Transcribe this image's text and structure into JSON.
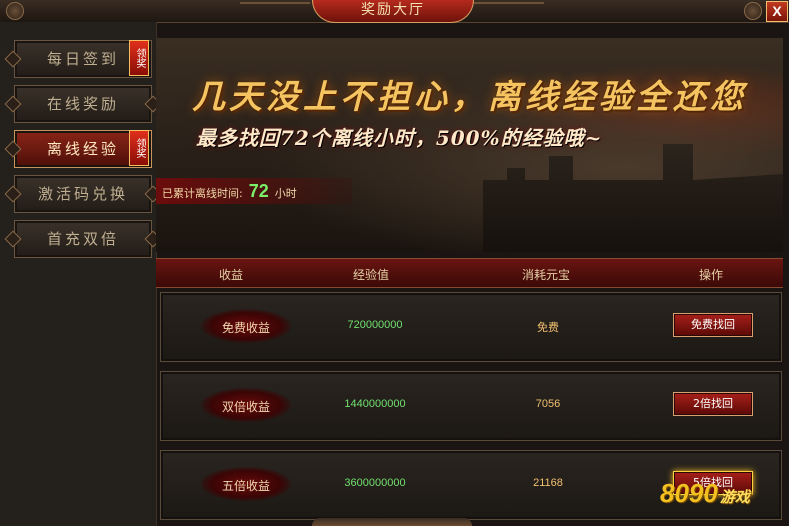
{
  "window": {
    "title": "奖励大厅",
    "close_label": "X"
  },
  "sidebar": {
    "items": [
      {
        "label": "每日签到",
        "badge": "领奖",
        "active": false
      },
      {
        "label": "在线奖励",
        "badge": "",
        "active": false
      },
      {
        "label": "离线经验",
        "badge": "领奖",
        "active": true
      },
      {
        "label": "激活码兑换",
        "badge": "",
        "active": false
      },
      {
        "label": "首充双倍",
        "badge": "",
        "active": false
      }
    ]
  },
  "banner": {
    "headline": "几天没上不担心，离线经验全还您",
    "subline": "最多找回72个离线小时，500%的经验哦~",
    "offline_label": "已累计离线时间:",
    "offline_hours": "72",
    "offline_unit": "小时"
  },
  "table": {
    "headers": {
      "reward": "收益",
      "exp": "经验值",
      "cost": "消耗元宝",
      "action": "操作"
    },
    "rows": [
      {
        "label": "免费收益",
        "exp": "720000000",
        "cost": "免费",
        "button": "免费找回"
      },
      {
        "label": "双倍收益",
        "exp": "1440000000",
        "cost": "7056",
        "button": "2倍找回"
      },
      {
        "label": "五倍收益",
        "exp": "3600000000",
        "cost": "21168",
        "button": "5倍找回"
      }
    ]
  },
  "watermark": {
    "text": "8090",
    "suffix": "游戏"
  }
}
